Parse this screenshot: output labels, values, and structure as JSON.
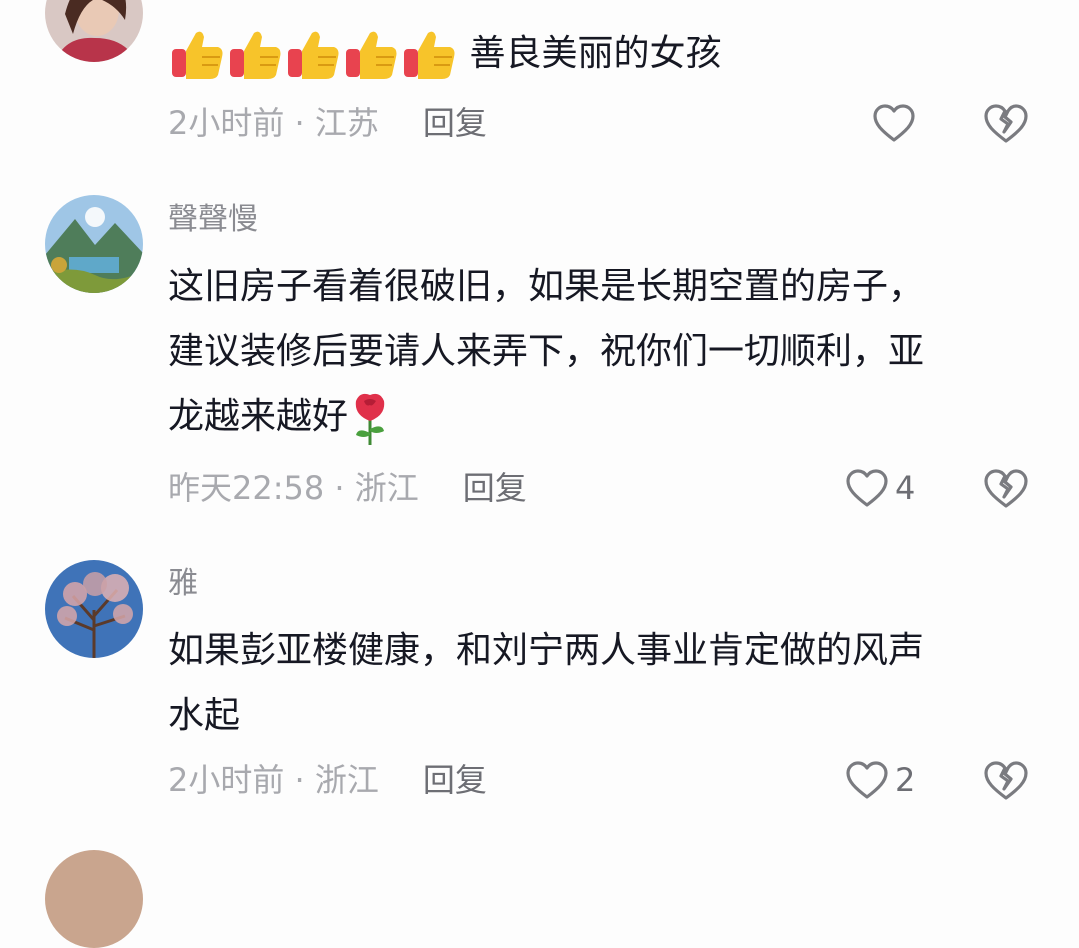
{
  "comments": [
    {
      "username": "",
      "text": "善良美丽的女孩",
      "emoji_prefix": [
        "thumbs-up",
        "thumbs-up",
        "thumbs-up",
        "thumbs-up",
        "thumbs-up"
      ],
      "time": "2小时前",
      "location": "江苏",
      "reply_label": "回复",
      "likes": ""
    },
    {
      "username": "聲聲慢",
      "text_lines": [
        "这旧房子看着很破旧，如果是长期空置的房子，",
        "建议装修后要请人来弄下，祝你们一切顺利，亚",
        "龙越来越好"
      ],
      "emoji_suffix": "rose",
      "time": "昨天22:58",
      "location": "浙江",
      "reply_label": "回复",
      "likes": "4"
    },
    {
      "username": "雅",
      "text_lines": [
        "如果彭亚楼健康，和刘宁两人事业肯定做的风声",
        "水起"
      ],
      "time": "2小时前",
      "location": "浙江",
      "reply_label": "回复",
      "likes": "2"
    }
  ],
  "separator": " · ",
  "icons": {
    "like": "heart-outline-icon",
    "dislike": "broken-heart-icon"
  }
}
